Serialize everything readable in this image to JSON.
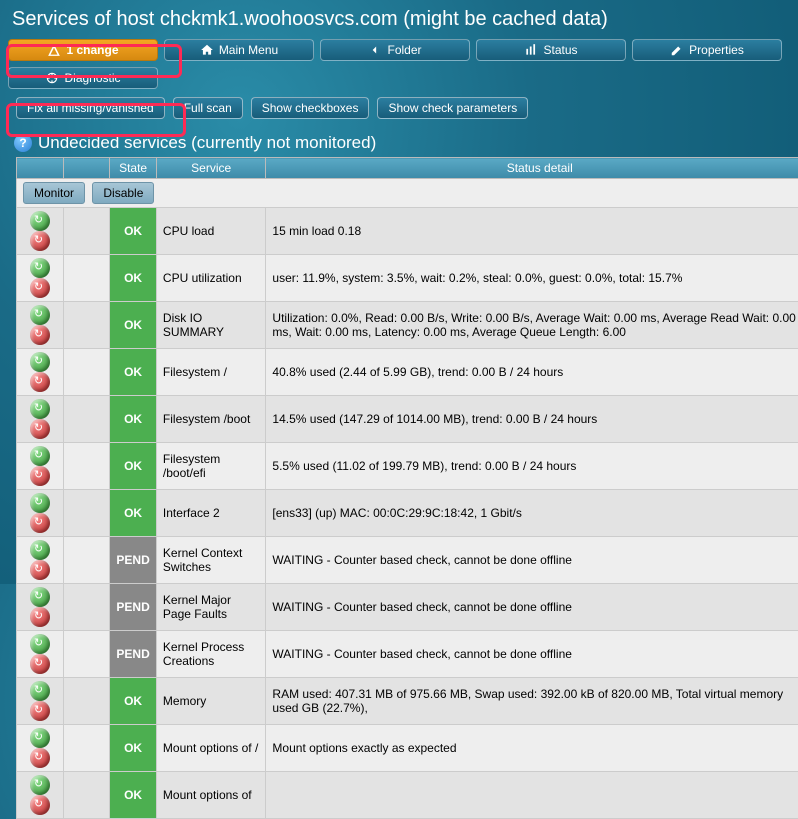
{
  "title": "Services of host chckmk1.woohoosvcs.com (might be cached data)",
  "topbar": {
    "changes": "1 change",
    "main_menu": "Main Menu",
    "folder": "Folder",
    "status": "Status",
    "properties": "Properties",
    "diagnostic": "Diagnostic"
  },
  "actionbar": {
    "fix": "Fix all missing/vanished",
    "full_scan": "Full scan",
    "show_checkboxes": "Show checkboxes",
    "show_params": "Show check parameters"
  },
  "section": {
    "heading": "Undecided services (currently not monitored)"
  },
  "table": {
    "headers": {
      "state": "State",
      "service": "Service",
      "detail": "Status detail"
    },
    "monitor": "Monitor",
    "disable": "Disable",
    "rows": [
      {
        "state": "OK",
        "service": "CPU load",
        "detail": "15 min load 0.18"
      },
      {
        "state": "OK",
        "service": "CPU utilization",
        "detail": "user: 11.9%, system: 3.5%, wait: 0.2%, steal: 0.0%, guest: 0.0%, total: 15.7%"
      },
      {
        "state": "OK",
        "service": "Disk IO SUMMARY",
        "detail": "Utilization: 0.0%, Read: 0.00 B/s, Write: 0.00 B/s, Average Wait: 0.00 ms, Average Read Wait: 0.00 ms, Wait: 0.00 ms, Latency: 0.00 ms, Average Queue Length: 6.00"
      },
      {
        "state": "OK",
        "service": "Filesystem /",
        "detail": "40.8% used (2.44 of 5.99 GB), trend: 0.00 B / 24 hours"
      },
      {
        "state": "OK",
        "service": "Filesystem /boot",
        "detail": "14.5% used (147.29 of 1014.00 MB), trend: 0.00 B / 24 hours"
      },
      {
        "state": "OK",
        "service": "Filesystem /boot/efi",
        "detail": "5.5% used (11.02 of 199.79 MB), trend: 0.00 B / 24 hours"
      },
      {
        "state": "OK",
        "service": "Interface 2",
        "detail": "[ens33] (up) MAC: 00:0C:29:9C:18:42, 1 Gbit/s"
      },
      {
        "state": "PEND",
        "service": "Kernel Context Switches",
        "detail": "WAITING - Counter based check, cannot be done offline"
      },
      {
        "state": "PEND",
        "service": "Kernel Major Page Faults",
        "detail": "WAITING - Counter based check, cannot be done offline"
      },
      {
        "state": "PEND",
        "service": "Kernel Process Creations",
        "detail": "WAITING - Counter based check, cannot be done offline"
      },
      {
        "state": "OK",
        "service": "Memory",
        "detail": "RAM used: 407.31 MB of 975.66 MB, Swap used: 392.00 kB of 820.00 MB, Total virtual memory used GB (22.7%),"
      },
      {
        "state": "OK",
        "service": "Mount options of /",
        "detail": "Mount options exactly as expected"
      },
      {
        "state": "OK",
        "service": "Mount options of",
        "detail": ""
      }
    ]
  }
}
